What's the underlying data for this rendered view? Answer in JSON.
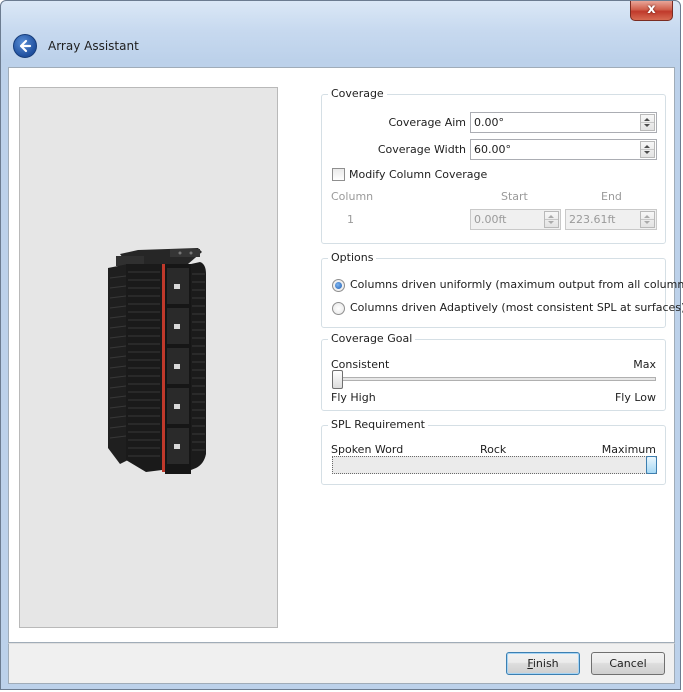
{
  "window": {
    "title": "Array Assistant",
    "close_glyph": "x"
  },
  "coverage": {
    "title": "Coverage",
    "aim_label": "Coverage Aim",
    "aim_value": "0.00°",
    "width_label": "Coverage Width",
    "width_value": "60.00°",
    "modify_label": "Modify Column Coverage",
    "modify_checked": false,
    "col_header": "Column",
    "start_header": "Start",
    "end_header": "End",
    "rows": [
      {
        "column": "1",
        "start": "0.00ft",
        "end": "223.61ft"
      }
    ]
  },
  "options": {
    "title": "Options",
    "items": [
      {
        "label": "Columns driven uniformly (maximum output from all columns)",
        "selected": true
      },
      {
        "label": "Columns driven Adaptively (most consistent SPL at surfaces)",
        "selected": false
      }
    ]
  },
  "coverage_goal": {
    "title": "Coverage Goal",
    "top_left": "Consistent",
    "top_right": "Max",
    "bottom_left": "Fly High",
    "bottom_right": "Fly Low",
    "level": 0.0
  },
  "spl": {
    "title": "SPL Requirement",
    "labels": [
      "Spoken Word",
      "Rock",
      "Maximum"
    ],
    "level": 1.0
  },
  "footer": {
    "finish_first": "F",
    "finish_rest": "inish",
    "cancel": "Cancel"
  },
  "colors": {
    "accent_red": "#c0392b",
    "speaker_black": "#1c1c1c"
  }
}
